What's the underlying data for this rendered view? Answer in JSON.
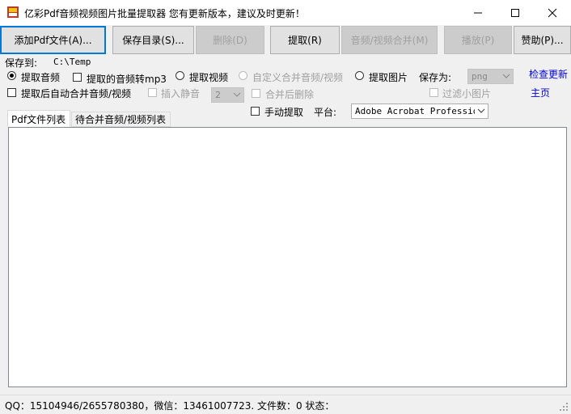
{
  "window": {
    "title": "亿彩Pdf音频视频图片批量提取器   您有更新版本，建议及时更新！"
  },
  "colors": {
    "accent": "#0078d7",
    "link": "#0000ee",
    "disabled_text": "#a0a0a0"
  },
  "toolbar": {
    "add_pdf": "添加Pdf文件(A)...",
    "save_dir": "保存目录(S)...",
    "delete": "删除(D)",
    "extract": "提取(R)",
    "merge_av": "音频/视频合并(M)",
    "play": "播放(P)",
    "sponsor": "赞助(P)..."
  },
  "options": {
    "save_to_label": "保存到:",
    "save_to_path": "C:\\Temp",
    "extract_audio": "提取音频",
    "audio_to_mp3": "提取的音频转mp3",
    "extract_video": "提取视频",
    "custom_merge": "自定义合并音频/视频",
    "extract_image": "提取图片",
    "save_as_label": "保存为:",
    "save_as_value": "png",
    "check_update": "检查更新",
    "homepage": "主页",
    "auto_merge": "提取后自动合并音频/视频",
    "insert_silence": "插入静音",
    "silence_value": "2",
    "delete_after_merge": "合并后删除",
    "filter_small_images": "过滤小图片",
    "manual_extract": "手动提取",
    "platform_label": "平台:",
    "platform_value": "Adobe Acrobat Professional"
  },
  "tabs": [
    {
      "label": "Pdf文件列表"
    },
    {
      "label": "待合并音频/视频列表"
    }
  ],
  "status": {
    "text": "QQ：15104946/2655780380，微信：13461007723. 文件数：0  状态："
  }
}
